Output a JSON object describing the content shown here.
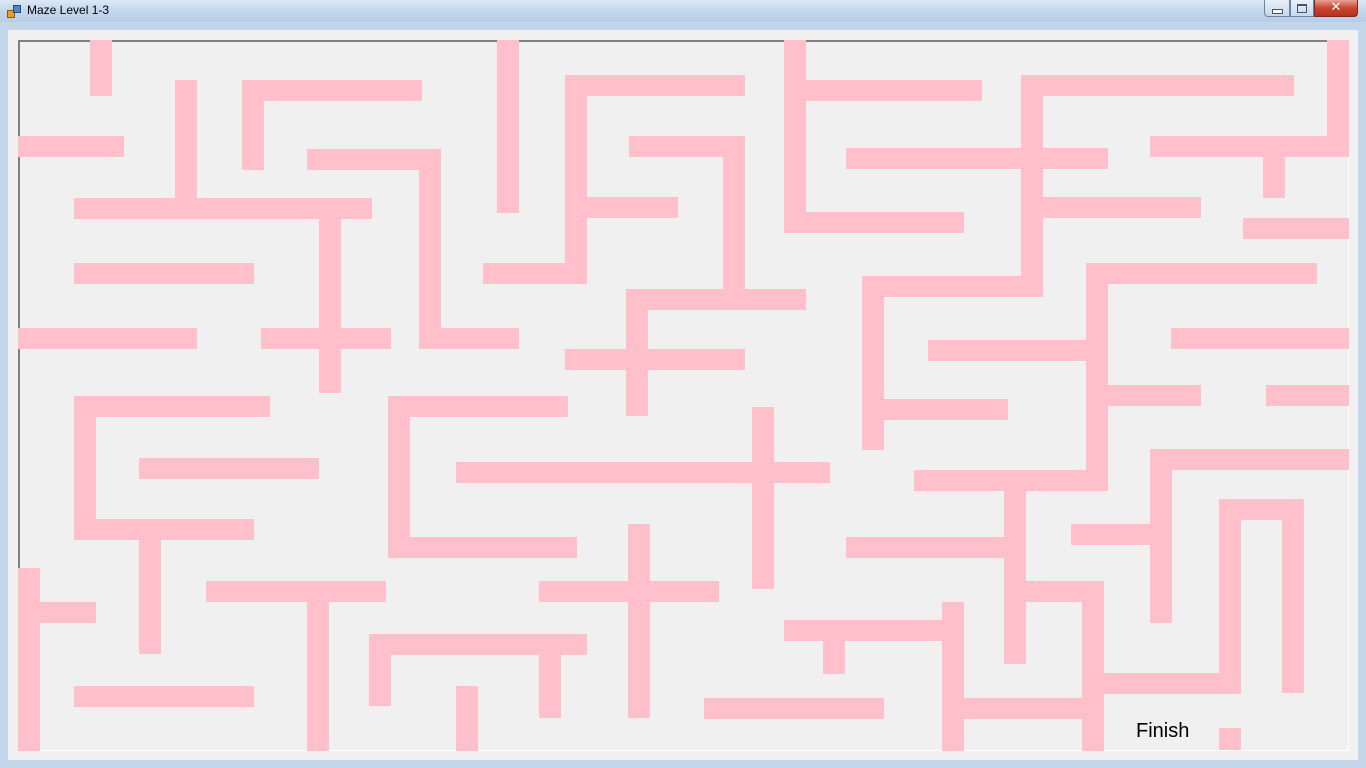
{
  "window": {
    "title": "Maze Level 1-3"
  },
  "maze": {
    "wall_color": "#ffc0cb",
    "background_color": "#f0f0f0",
    "finish_label": "Finish"
  },
  "icons": {
    "app": "maze-app-icon",
    "minimize": "minimize-icon",
    "maximize": "maximize-icon",
    "close": "close-icon"
  }
}
